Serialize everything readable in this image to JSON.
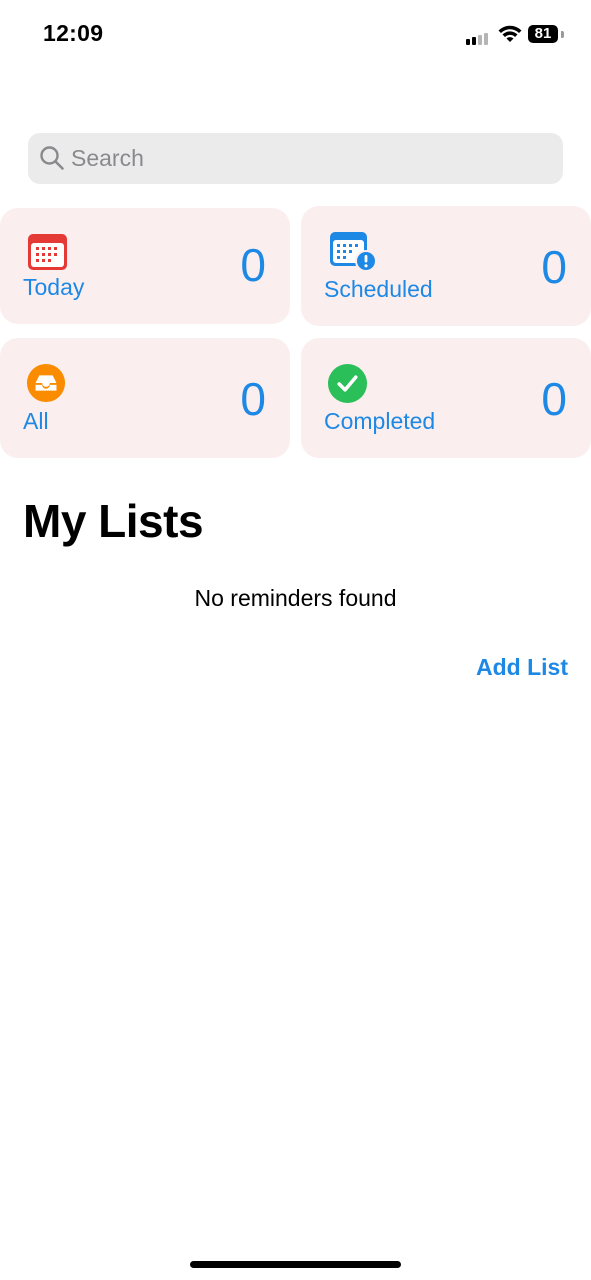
{
  "status_bar": {
    "time": "12:09",
    "battery_level": "81"
  },
  "search": {
    "placeholder": "Search"
  },
  "smart_lists": {
    "today": {
      "label": "Today",
      "count": "0"
    },
    "scheduled": {
      "label": "Scheduled",
      "count": "0"
    },
    "all": {
      "label": "All",
      "count": "0"
    },
    "completed": {
      "label": "Completed",
      "count": "0"
    }
  },
  "my_lists": {
    "title": "My Lists",
    "empty_message": "No reminders found",
    "add_list_label": "Add List"
  },
  "colors": {
    "accent": "#1e88e5",
    "tile_background": "#fbeeee",
    "today_icon": "#e53935",
    "scheduled_icon": "#1e88e5",
    "all_icon": "#fb8c00",
    "completed_icon": "#2bbf5a"
  },
  "icons": {
    "search": "search-icon",
    "today": "calendar-icon",
    "scheduled": "calendar-alert-icon",
    "all": "inbox-tray-icon",
    "completed": "checkmark-circle-icon"
  }
}
